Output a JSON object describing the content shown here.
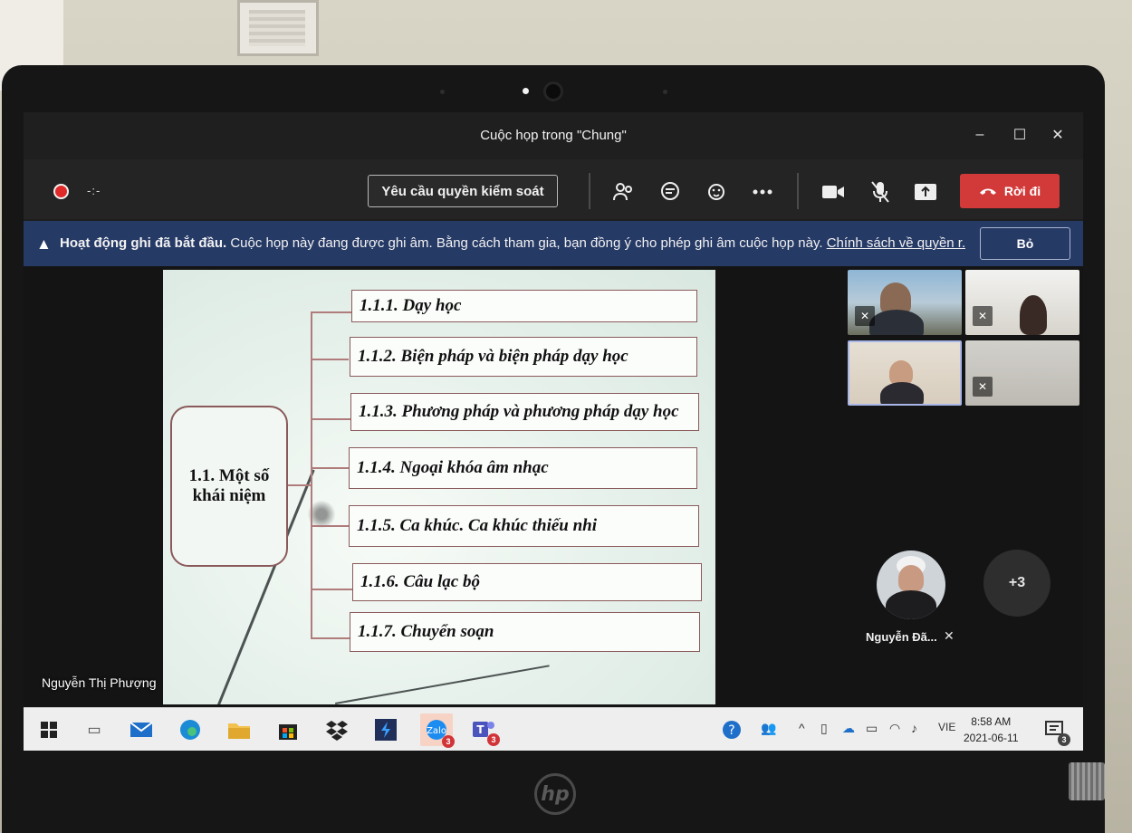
{
  "window": {
    "title": "Cuộc họp trong \"Chung\"",
    "minimize_label": "–",
    "maximize_label": "☐",
    "close_label": "✕"
  },
  "toolbar": {
    "recording_timer": "-:-",
    "control_request_label": "Yêu cầu quyền kiểm soát",
    "leave_label": "Rời đi",
    "icons": [
      "participants-icon",
      "chat-icon",
      "reactions-icon",
      "more-options-icon",
      "camera-icon",
      "microphone-icon",
      "share-icon"
    ]
  },
  "banner": {
    "title": "Hoạt động ghi đã bắt đầu.",
    "message": "Cuộc họp này đang được ghi âm. Bằng cách tham gia, bạn đồng ý cho phép ghi âm cuộc họp này.",
    "link": "Chính sách về quyền r...",
    "dismiss_label": "Bỏ"
  },
  "slide": {
    "main_concept": "1.1. Một số khái niệm",
    "items": [
      "1.1.1. Dạy học",
      "1.1.2. Biện pháp và biện pháp dạy học",
      "1.1.3. Phương pháp và phương pháp dạy học",
      "1.1.4. Ngoại khóa âm nhạc",
      "1.1.5. Ca khúc. Ca khúc thiếu nhi",
      "1.1.6. Câu lạc bộ",
      "1.1.7. Chuyển soạn"
    ]
  },
  "presenter": {
    "name": "Nguyễn Thị Phượng"
  },
  "participants": {
    "avatar_name": "Nguyễn Đã...",
    "overflow_count": "+3"
  },
  "taskbar": {
    "language": "VIE",
    "time": "8:58 AM",
    "date": "2021-06-11",
    "zalo_badge": "3",
    "teams_badge": "3",
    "notification_badge": "3"
  },
  "colors": {
    "leave_button": "#d23a3a",
    "banner_background": "#263a66",
    "recording_dot": "#e02929",
    "accent_border": "#8a5a5a"
  }
}
